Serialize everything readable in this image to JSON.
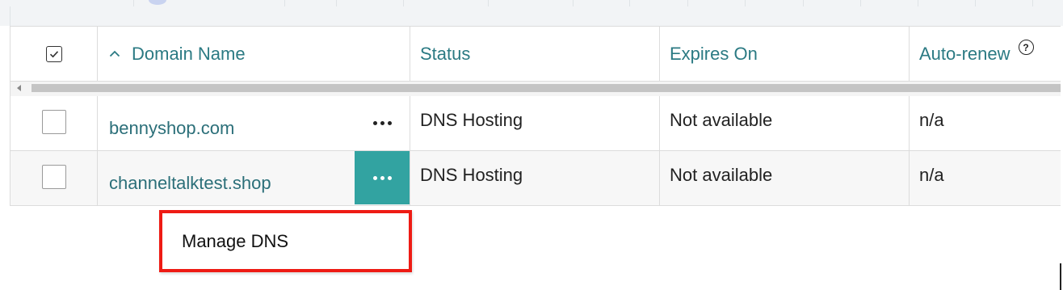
{
  "table": {
    "columns": {
      "domain": "Domain Name",
      "status": "Status",
      "expires": "Expires On",
      "autorenew": "Auto-renew"
    },
    "rows": [
      {
        "domain": "bennyshop.com",
        "status": "DNS Hosting",
        "expires": "Not available",
        "autorenew": "n/a"
      },
      {
        "domain": "channeltalktest.shop",
        "status": "DNS Hosting",
        "expires": "Not available",
        "autorenew": "n/a"
      }
    ]
  },
  "context_menu": {
    "items": [
      "Manage DNS"
    ]
  },
  "icons": {
    "select_all": "checkbox-icon",
    "sort": "chevron-up-icon",
    "help": "help-circle-icon",
    "row_actions": "more-horizontal-icon"
  },
  "colors": {
    "header_text": "#2b7a83",
    "link": "#2b6f79",
    "active_action": "#32a3a1",
    "highlight_border": "#ee1b14"
  }
}
